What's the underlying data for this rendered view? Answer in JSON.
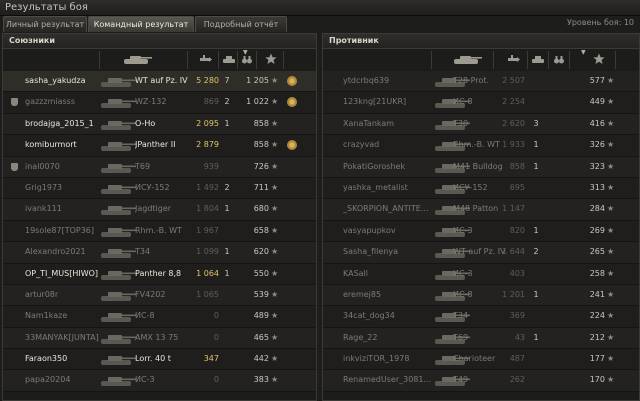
{
  "window": {
    "title": "Результаты боя"
  },
  "tabs": [
    {
      "label": "Личный результат",
      "active": false
    },
    {
      "label": "Командный результат",
      "active": true
    },
    {
      "label": "Подробный отчёт",
      "active": false
    }
  ],
  "battle_level": "Уровень боя: 10",
  "allies": {
    "title": "Союзники",
    "rows": [
      {
        "name": "sasha_yakudza",
        "tank": "WT auf Pz. IV",
        "damage": "5 280",
        "kills": "7",
        "xp": "1 205",
        "alive": true,
        "player": true,
        "award": true
      },
      {
        "name": "gazzzmiasss",
        "tank": "WZ-132",
        "damage": "869",
        "kills": "2",
        "xp": "1 022",
        "alive": false,
        "clan_icon": true,
        "award": true
      },
      {
        "name": "brodajga_2015_1",
        "tank": "O-Ho",
        "damage": "2 095",
        "kills": "1",
        "xp": "858",
        "alive": true
      },
      {
        "name": "komiburmort",
        "tank": "JPanther II",
        "damage": "2 879",
        "kills": "",
        "xp": "858",
        "alive": true,
        "award": true
      },
      {
        "name": "inal0070",
        "tank": "T69",
        "damage": "939",
        "kills": "",
        "xp": "726",
        "alive": false,
        "clan_icon": true
      },
      {
        "name": "Grig1973",
        "tank": "ИСУ-152",
        "damage": "1 492",
        "kills": "2",
        "xp": "711",
        "alive": false
      },
      {
        "name": "ivank111",
        "tank": "Jagdtiger",
        "damage": "1 804",
        "kills": "1",
        "xp": "680",
        "alive": false
      },
      {
        "name": "19sole87[TOP36]",
        "tank": "Rhm.-B. WT",
        "damage": "1 967",
        "kills": "",
        "xp": "658",
        "alive": false
      },
      {
        "name": "Alexandro2021",
        "tank": "T34",
        "damage": "1 099",
        "kills": "1",
        "xp": "620",
        "alive": false
      },
      {
        "name": "OP_TI_MUS[HIWO]",
        "tank": "Panther 8,8",
        "damage": "1 064",
        "kills": "1",
        "xp": "550",
        "alive": true
      },
      {
        "name": "artur08r",
        "tank": "FV4202",
        "damage": "1 065",
        "kills": "",
        "xp": "539",
        "alive": false
      },
      {
        "name": "Nam1kaze",
        "tank": "ИС-8",
        "damage": "0",
        "kills": "",
        "xp": "489",
        "alive": false
      },
      {
        "name": "33MANYAK[JUNTA]",
        "tank": "AMX 13 75",
        "damage": "0",
        "kills": "",
        "xp": "465",
        "alive": false
      },
      {
        "name": "Faraon350",
        "tank": "Lorr. 40 t",
        "damage": "347",
        "kills": "",
        "xp": "442",
        "alive": true
      },
      {
        "name": "papa20204",
        "tank": "ИС-3",
        "damage": "0",
        "kills": "",
        "xp": "383",
        "alive": false
      }
    ]
  },
  "enemies": {
    "title": "Противник",
    "rows": [
      {
        "name": "ytdcrbq639",
        "tank": "T28 Prot.",
        "damage": "2 507",
        "kills": "",
        "xp": "577"
      },
      {
        "name": "123kng[21UKR]",
        "tank": "ИС-8",
        "damage": "2 254",
        "kills": "",
        "xp": "449"
      },
      {
        "name": "XanaTankam",
        "tank": "T30",
        "damage": "2 620",
        "kills": "3",
        "xp": "416"
      },
      {
        "name": "crazyvad",
        "tank": "Rhm.-B. WT",
        "damage": "1 933",
        "kills": "1",
        "xp": "326"
      },
      {
        "name": "PokatiGoroshek",
        "tank": "M41 Bulldog",
        "damage": "858",
        "kills": "1",
        "xp": "323"
      },
      {
        "name": "yashka_metalist",
        "tank": "ИСУ-152",
        "damage": "695",
        "kills": "",
        "xp": "313"
      },
      {
        "name": "_SKORPION_ANTITE...",
        "tank": "M48 Patton",
        "damage": "1 147",
        "kills": "",
        "xp": "284"
      },
      {
        "name": "vasyapupkov",
        "tank": "ИС-3",
        "damage": "820",
        "kills": "1",
        "xp": "269"
      },
      {
        "name": "Sasha_filenya",
        "tank": "WT auf Pz. IV",
        "damage": "1 644",
        "kills": "2",
        "xp": "265"
      },
      {
        "name": "KASall",
        "tank": "ИС-3",
        "damage": "403",
        "kills": "",
        "xp": "258"
      },
      {
        "name": "eremej85",
        "tank": "ИС-8",
        "damage": "1 201",
        "kills": "1",
        "xp": "241"
      },
      {
        "name": "34cat_dog34",
        "tank": "T34",
        "damage": "369",
        "kills": "",
        "xp": "224"
      },
      {
        "name": "Rage_22",
        "tank": "T69",
        "damage": "43",
        "kills": "1",
        "xp": "212"
      },
      {
        "name": "inkviziTOR_1978",
        "tank": "Charioteer",
        "damage": "487",
        "kills": "",
        "xp": "177"
      },
      {
        "name": "RenamedUser_3081...",
        "tank": "T49",
        "damage": "262",
        "kills": "",
        "xp": "170"
      }
    ]
  },
  "icons": {
    "tank_column": "tank-icon",
    "damage_column": "shell-icon",
    "kills_column": "destroyed-tank-icon",
    "spotted_column": "binoculars-icon",
    "xp_column": "star-icon",
    "award": "medal-icon",
    "clan": "clan-shield-icon"
  },
  "colors": {
    "damage_highlight": "#e0c46a",
    "alive_text": "#eae7da",
    "dead_text": "#7d7b74"
  }
}
